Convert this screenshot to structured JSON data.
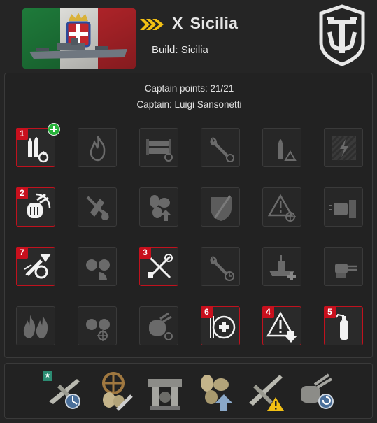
{
  "ship": {
    "tier_label": "X",
    "name": "Sicilia",
    "build_label": "Build: Sicilia"
  },
  "nation": "italy",
  "captain": {
    "points_label": "Captain points: 21/21",
    "name_label": "Captain: Luigi Sansonetti"
  },
  "skills": [
    {
      "icon": "shells-reload-icon",
      "selected": true,
      "order": "1",
      "plus": true
    },
    {
      "icon": "fire-icon",
      "selected": false
    },
    {
      "icon": "torpedo-reload-icon",
      "selected": false
    },
    {
      "icon": "wrench-reload-icon",
      "selected": false
    },
    {
      "icon": "shell-warning-icon",
      "selected": false
    },
    {
      "icon": "lightning-hatched-icon",
      "selected": false
    },
    {
      "icon": "aa-gun-burst-icon",
      "selected": true,
      "order": "2"
    },
    {
      "icon": "fire-shield-crossed-icon",
      "selected": false
    },
    {
      "icon": "propeller-up-icon",
      "selected": false
    },
    {
      "icon": "shield-sword-icon",
      "selected": false
    },
    {
      "icon": "warning-crosshair-icon",
      "selected": false
    },
    {
      "icon": "turret-armor-icon",
      "selected": false
    },
    {
      "icon": "aa-flak-burst-icon",
      "selected": true,
      "order": "7"
    },
    {
      "icon": "dual-turret-half-icon",
      "selected": false
    },
    {
      "icon": "crossed-tools-icon",
      "selected": true,
      "order": "3"
    },
    {
      "icon": "wrench-timer-icon",
      "selected": false
    },
    {
      "icon": "battleship-plus-icon",
      "selected": false
    },
    {
      "icon": "secondary-gun-icon",
      "selected": false
    },
    {
      "icon": "double-fire-icon",
      "selected": false
    },
    {
      "icon": "dual-turret-crosshair-icon",
      "selected": false
    },
    {
      "icon": "aa-gun-reload-icon",
      "selected": false
    },
    {
      "icon": "heal-plus-icon",
      "selected": true,
      "order": "6"
    },
    {
      "icon": "warning-down-icon",
      "selected": true,
      "order": "4"
    },
    {
      "icon": "fire-extinguisher-icon",
      "selected": true,
      "order": "5"
    }
  ],
  "modules": [
    {
      "icon": "aircraft-radar-module-icon",
      "badge": "★"
    },
    {
      "icon": "steering-wrench-module-icon"
    },
    {
      "icon": "machinery-module-icon"
    },
    {
      "icon": "propeller-up-module-icon"
    },
    {
      "icon": "aircraft-warning-module-icon"
    },
    {
      "icon": "turret-reload-module-icon"
    }
  ]
}
